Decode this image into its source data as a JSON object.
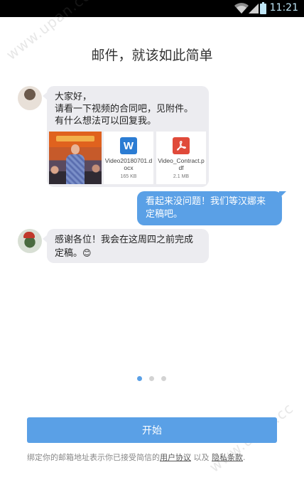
{
  "status_bar": {
    "time": "11:21",
    "icons": [
      "wifi-icon",
      "signal-icon",
      "battery-icon"
    ]
  },
  "title": "邮件，就该如此简单",
  "messages": [
    {
      "direction": "incoming",
      "avatar": "avatar-man-icon",
      "text": "大家好，\n请看一下视频的合同吧，见附件。\n有什么想法可以回复我。",
      "attachments": [
        {
          "type": "video-thumbnail",
          "icon": "video-thumbnail-icon"
        },
        {
          "type": "word",
          "icon_letter": "W",
          "name": "Video20180701.docx",
          "size": "165 KB"
        },
        {
          "type": "pdf",
          "name": "Video_Contract.pdf",
          "size": "2.1 MB"
        }
      ]
    },
    {
      "direction": "outgoing",
      "text": "看起来没问题！我们等汉娜来\n定稿吧。"
    },
    {
      "direction": "incoming",
      "avatar": "avatar-person-icon",
      "text": "感谢各位！我会在这周四之前完成\n定稿。",
      "emoji": "😊"
    }
  ],
  "pager": {
    "count": 3,
    "active": 0
  },
  "start_button": "开始",
  "footer": {
    "prefix": "绑定你的邮箱地址表示你已接受简信的",
    "link1": "用户协议",
    "middle": " 以及 ",
    "link2": "隐私条款",
    "suffix": "."
  },
  "watermark": "www.upan.cc",
  "colors": {
    "accent": "#5aa0e6",
    "incoming_bubble": "#ececf0",
    "word_blue": "#2b7cd3",
    "pdf_red": "#e04a3a"
  }
}
